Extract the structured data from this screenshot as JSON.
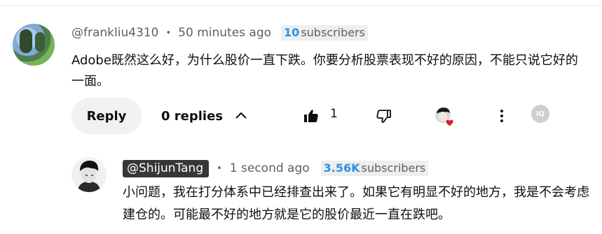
{
  "comment": {
    "handle": "@frankliu4310",
    "separator": "•",
    "time": "50 minutes ago",
    "subscribers_count": "10",
    "subscribers_label": "subscribers",
    "text": "Adobe既然这么好，为什么股价一直下跌。你要分析股票表现不好的原因，不能只说它好的一面。"
  },
  "actions": {
    "reply_label": "Reply",
    "replies_label": "0 replies",
    "like_count": "1",
    "iq_label": "IQ"
  },
  "reply": {
    "handle": "@ShijunTang",
    "separator": "•",
    "time": "1 second ago",
    "subscribers_count": "3.56K",
    "subscribers_label": "subscribers",
    "text": "小问题，我在打分体系中已经排查出来了。如果它有明显不好的地方，我是不会考虑建仓的。可能最不好的地方就是它的股价最近一直在跌吧。"
  },
  "icons": {
    "like": "thumbs-up-filled-icon",
    "dislike": "thumbs-down-outline-icon",
    "creator_heart": "creator-heart-icon",
    "more": "more-vertical-icon",
    "collapse": "chevron-up-icon",
    "iq": "iq-extension-icon"
  },
  "colors": {
    "subscribers_accent": "#2f8fe6",
    "heart": "#e0182a",
    "owner_pill_bg": "#373737",
    "button_bg": "#f1f1f1"
  }
}
